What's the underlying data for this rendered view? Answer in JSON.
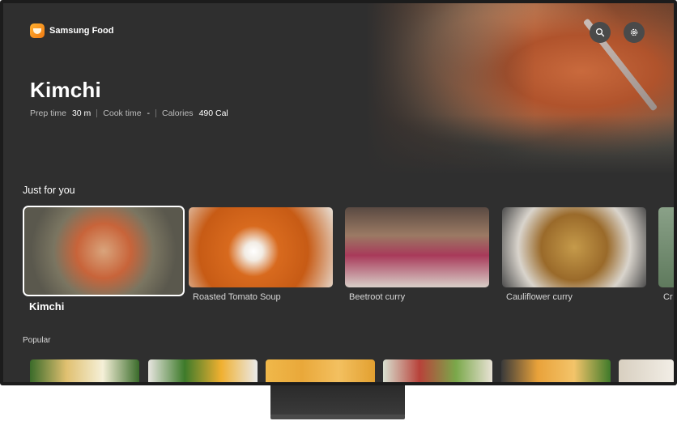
{
  "app": {
    "name": "Samsung Food"
  },
  "hero": {
    "title": "Kimchi",
    "prep_label": "Prep time",
    "prep_value": "30 m",
    "cook_label": "Cook time",
    "cook_value": "-",
    "calories_label": "Calories",
    "calories_value": "490 Cal"
  },
  "header_icons": [
    "search-icon",
    "gear-icon"
  ],
  "sections": {
    "just_for_you": {
      "label": "Just for you",
      "items": [
        {
          "title": "Kimchi",
          "focused": true
        },
        {
          "title": "Roasted Tomato Soup"
        },
        {
          "title": "Beetroot curry"
        },
        {
          "title": "Cauliflower curry"
        },
        {
          "title": "Cr"
        }
      ]
    },
    "popular": {
      "label": "Popular"
    }
  },
  "colors": {
    "background": "#2f2f2f",
    "accent": "#f59a1c",
    "text": "#ffffff"
  }
}
